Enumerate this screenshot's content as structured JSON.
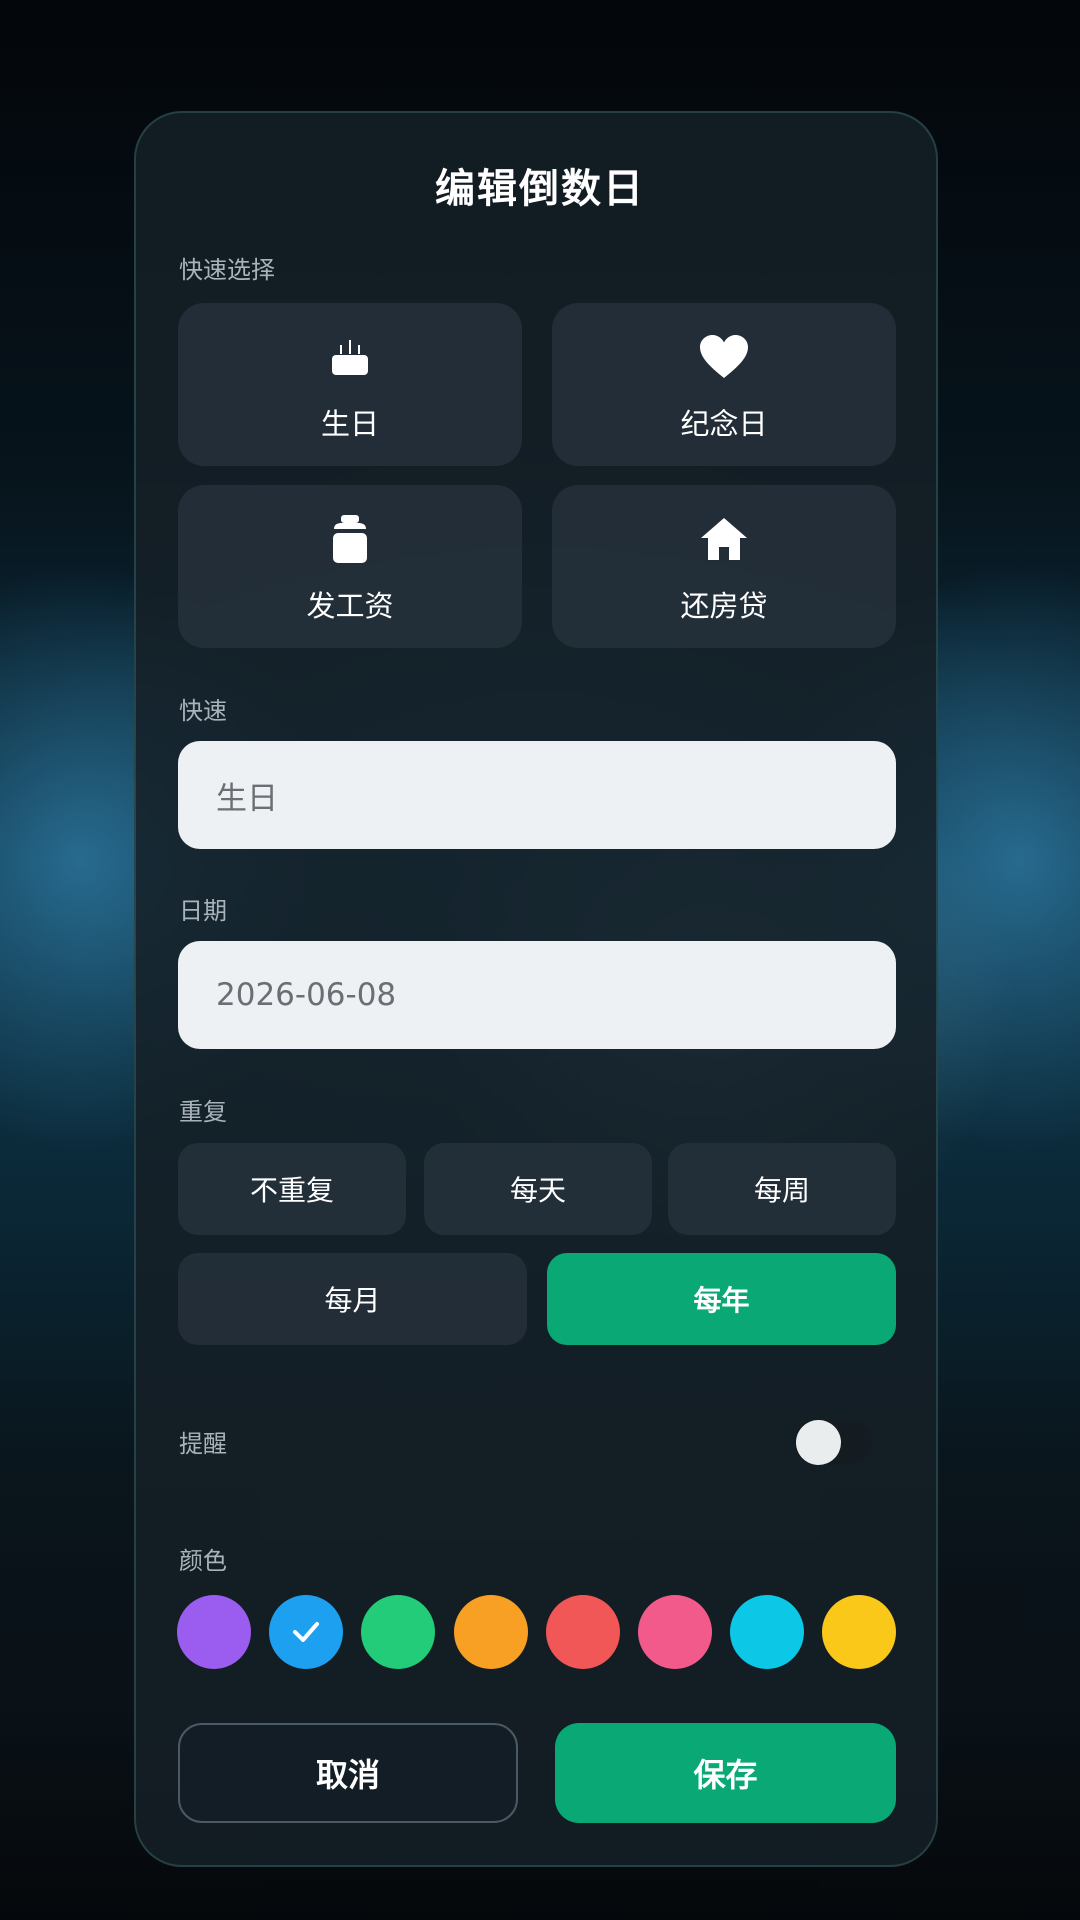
{
  "dialog": {
    "title": "编辑倒数日"
  },
  "quick_select": {
    "label": "快速选择",
    "items": [
      {
        "label": "生日",
        "icon": "cake-icon"
      },
      {
        "label": "纪念日",
        "icon": "heart-icon"
      },
      {
        "label": "发工资",
        "icon": "money-bag-icon"
      },
      {
        "label": "还房贷",
        "icon": "house-icon"
      }
    ]
  },
  "name_field": {
    "label": "快速",
    "value": "生日"
  },
  "date_field": {
    "label": "日期",
    "value": "2026-06-08"
  },
  "repeat": {
    "label": "重复",
    "options": [
      "不重复",
      "每天",
      "每周",
      "每月",
      "每年"
    ],
    "selected": "每年"
  },
  "reminder": {
    "label": "提醒",
    "enabled": false
  },
  "color": {
    "label": "颜色",
    "swatches": [
      "#9b5cf0",
      "#1ea0f0",
      "#22cc78",
      "#f7a024",
      "#f25757",
      "#f25a8c",
      "#0cc8e6",
      "#fac818"
    ],
    "selected": "#1ea0f0",
    "check_icon": "check-icon"
  },
  "actions": {
    "cancel_label": "取消",
    "save_label": "保存"
  },
  "colors": {
    "accent": "#0aa874",
    "card": "#151f27",
    "input_bg": "#eef1f3"
  }
}
